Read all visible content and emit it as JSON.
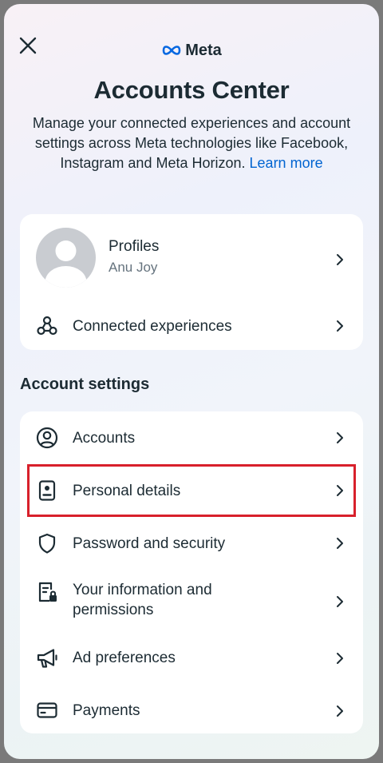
{
  "header": {
    "close_icon": "close-icon",
    "brand": "Meta",
    "brand_icon": "meta-infinity-icon",
    "title": "Accounts Center",
    "description": "Manage your connected experiences and account settings across Meta technologies like Facebook, Instagram and Meta Horizon.",
    "learn_more": "Learn more"
  },
  "profiles_card": {
    "profile_label": "Profiles",
    "profile_name": "Anu Joy",
    "connected_label": "Connected experiences"
  },
  "section_title": "Account settings",
  "settings": [
    {
      "label": "Accounts",
      "icon": "user-circle-icon"
    },
    {
      "label": "Personal details",
      "icon": "id-card-icon"
    },
    {
      "label": "Password and security",
      "icon": "shield-icon"
    },
    {
      "label": "Your information and permissions",
      "icon": "document-lock-icon"
    },
    {
      "label": "Ad preferences",
      "icon": "megaphone-icon"
    },
    {
      "label": "Payments",
      "icon": "credit-card-icon"
    }
  ],
  "colors": {
    "link": "#0064d1",
    "highlight": "#d8202b",
    "text": "#1c2b33"
  }
}
